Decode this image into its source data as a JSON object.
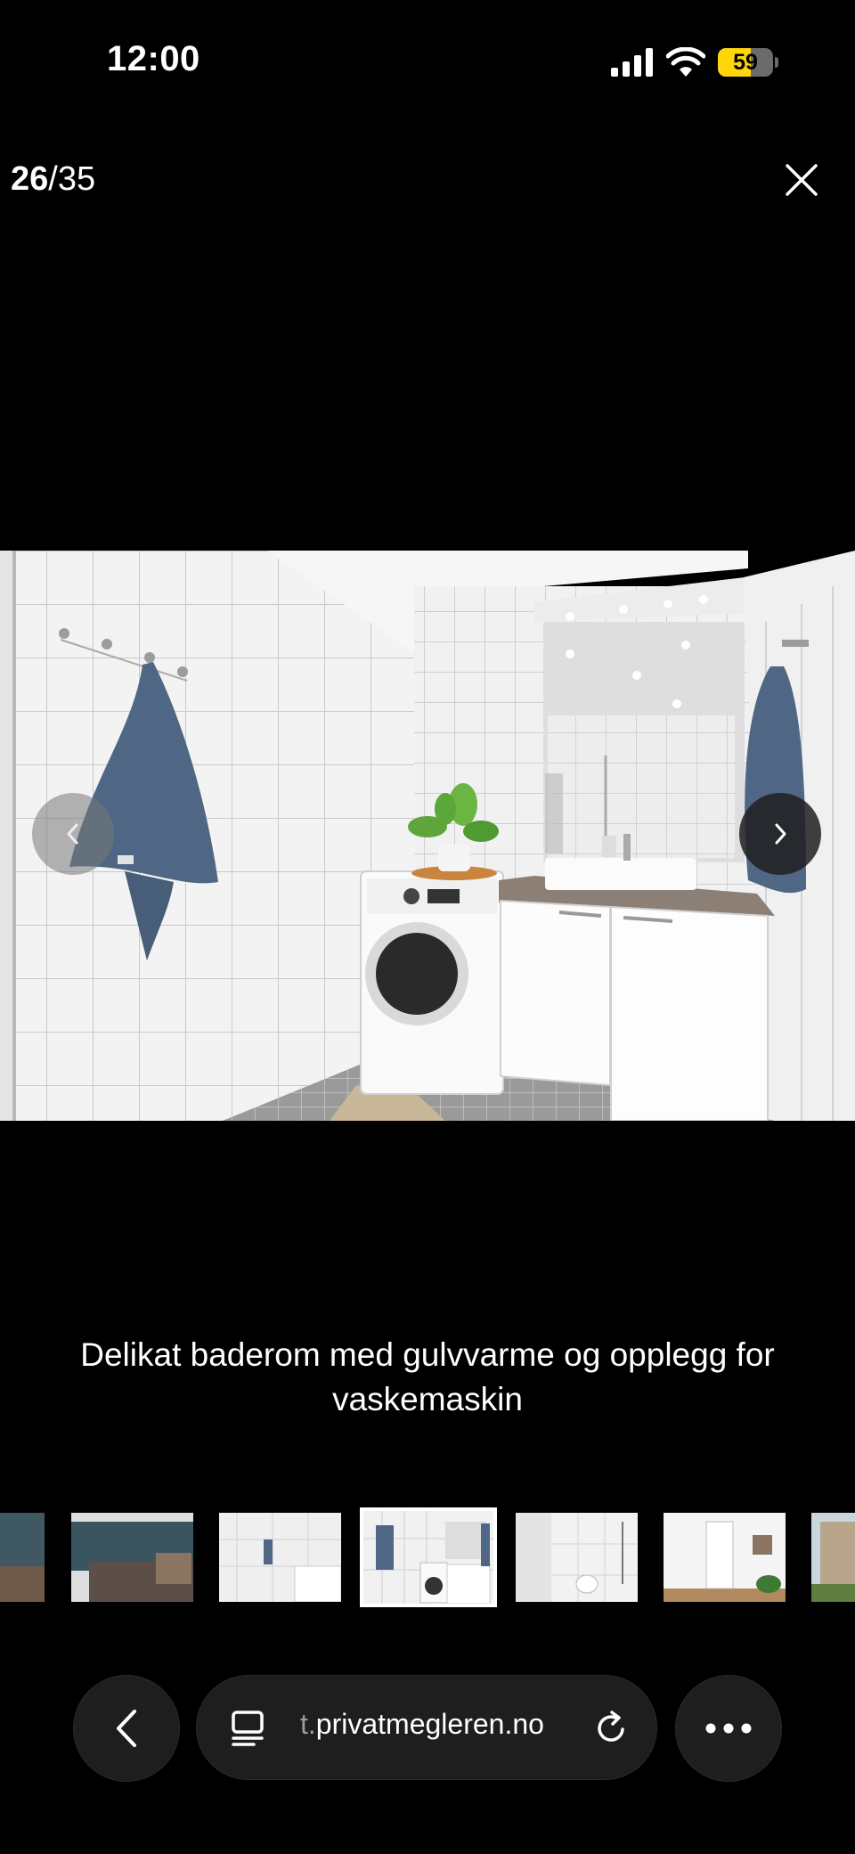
{
  "status_bar": {
    "time": "12:00",
    "battery": "59",
    "battery_level": 0.59
  },
  "viewer": {
    "current": "26",
    "separator_total": "/35",
    "close_icon": "close-icon",
    "caption": "Delikat baderom med gulvvarme og opplegg for vaskemaskin"
  },
  "browser": {
    "url_prefix": "t.",
    "url_main": "privatmegleren.no",
    "icons": [
      "back-icon",
      "tab-overview-icon",
      "reload-icon",
      "more-icon"
    ]
  }
}
